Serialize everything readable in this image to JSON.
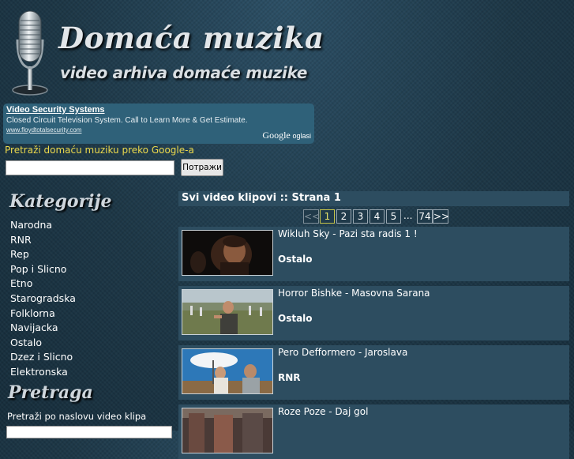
{
  "header": {
    "title": "Domaća muzika",
    "subtitle": "video arhiva domaće muzike"
  },
  "ad": {
    "title": "Video Security Systems",
    "text": "Closed Circuit Television System. Call to Learn More & Get Estimate.",
    "url": "www.floydtotalsecurity.com",
    "brand": "Google",
    "brand_suffix": "oglasi"
  },
  "google_search": {
    "label": "Pretraži domaću muziku preko Google-a",
    "input_value": "",
    "button_label": "Потражи"
  },
  "sidebar": {
    "categories_heading": "Kategorije",
    "categories": [
      "Narodna",
      "RNR",
      "Rep",
      "Pop i Slicno",
      "Etno",
      "Starogradska",
      "Folklorna",
      "Navijacka",
      "Ostalo",
      "Dzez i Slicno",
      "Elektronska"
    ],
    "search_heading": "Pretraga",
    "search_label": "Pretraži po naslovu video klipa",
    "search_value": ""
  },
  "main": {
    "section_title": "Svi video klipovi :: Strana 1",
    "pagination": {
      "prev": "<<",
      "pages": [
        "1",
        "2",
        "3",
        "4",
        "5"
      ],
      "current": "1",
      "ellipsis": "...",
      "last": "74",
      "next": ">>"
    },
    "videos": [
      {
        "title": "Wikluh Sky - Pazi sta radis 1 !",
        "category": "Ostalo"
      },
      {
        "title": "Horror Bishke - Masovna Sarana",
        "category": "Ostalo"
      },
      {
        "title": "Pero Defformero - Jaroslava",
        "category": "RNR"
      },
      {
        "title": "Roze Poze - Daj gol",
        "category": ""
      }
    ]
  },
  "colors": {
    "background": "#1d3747",
    "panel": "#2d4d60",
    "ad_background": "#2f6179",
    "google_label": "#ecd94c",
    "current_page": "#e8e46a"
  },
  "icons": [
    "microphone-icon"
  ]
}
